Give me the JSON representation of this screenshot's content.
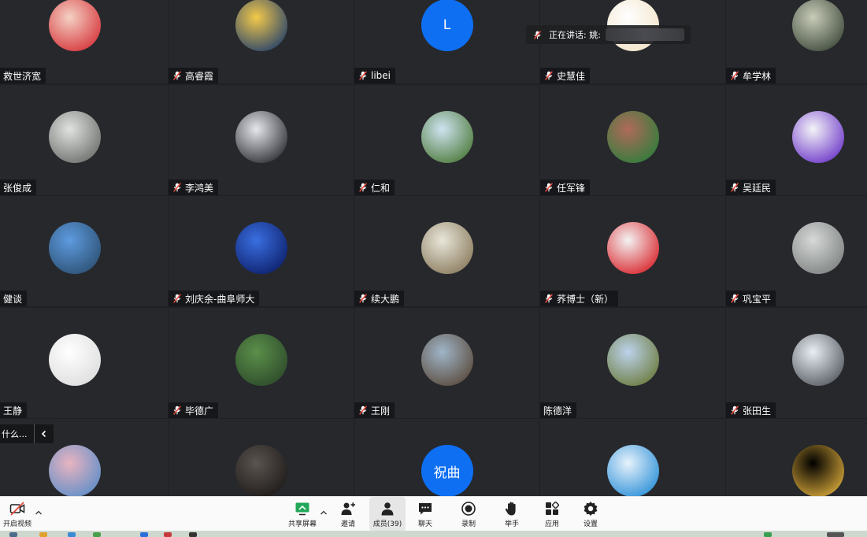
{
  "speaking_label": "正在讲话: 姚:",
  "chat_preview": "什么...",
  "participants": [
    {
      "name": "救世济宽",
      "muted": false,
      "avatar": "photo-child-red-jacket",
      "colors": [
        "#f4d1c4",
        "#d6343a"
      ]
    },
    {
      "name": "高睿霞",
      "muted": true,
      "avatar": "photo-moon-art",
      "colors": [
        "#f3c94a",
        "#24406b"
      ]
    },
    {
      "name": "libei",
      "muted": true,
      "avatar": "letter-avatar",
      "letter": "L",
      "colors": [
        "#0e6ff2",
        "#0e6ff2"
      ]
    },
    {
      "name": "史慧佳",
      "muted": true,
      "avatar": "photo-cartoon-couple",
      "colors": [
        "#ffffff",
        "#f2e3c8"
      ]
    },
    {
      "name": "牟学林",
      "muted": true,
      "avatar": "photo-window-cat",
      "colors": [
        "#c8ccb8",
        "#3f4a3c"
      ]
    },
    {
      "name": "张俊成",
      "muted": false,
      "avatar": "photo-bronze-cauldron",
      "colors": [
        "#e0e3e0",
        "#6b6e6a"
      ]
    },
    {
      "name": "李鸿美",
      "muted": true,
      "avatar": "photo-woman-portrait",
      "colors": [
        "#e6e7ec",
        "#2c2d33"
      ]
    },
    {
      "name": "仁和",
      "muted": true,
      "avatar": "photo-lake-trees",
      "colors": [
        "#cfe3f0",
        "#4c7a3a"
      ]
    },
    {
      "name": "任军锋",
      "muted": true,
      "avatar": "photo-lotus-building",
      "colors": [
        "#b06a5a",
        "#2e7d3a"
      ]
    },
    {
      "name": "吴廷民",
      "muted": true,
      "avatar": "photo-purple-face",
      "colors": [
        "#f4f4f8",
        "#6c36c8"
      ]
    },
    {
      "name": "健谈",
      "muted": false,
      "avatar": "photo-river-town",
      "colors": [
        "#5e9be0",
        "#2c5072"
      ]
    },
    {
      "name": "刘庆余-曲阜师大",
      "muted": true,
      "avatar": "photo-blue-poster",
      "colors": [
        "#3a6fe0",
        "#0d1f6b"
      ]
    },
    {
      "name": "续大鹏",
      "muted": true,
      "avatar": "photo-family-walk",
      "colors": [
        "#e8e6da",
        "#8a7a5c"
      ]
    },
    {
      "name": "荞博士（新）",
      "muted": true,
      "avatar": "photo-boy-flag",
      "colors": [
        "#f3f3f3",
        "#d8232a"
      ]
    },
    {
      "name": "巩宝平",
      "muted": true,
      "avatar": "photo-bubbles",
      "colors": [
        "#d6d9d8",
        "#7d8180"
      ]
    },
    {
      "name": "王静",
      "muted": false,
      "avatar": "photo-meme-face",
      "colors": [
        "#ffffff",
        "#dddddd"
      ]
    },
    {
      "name": "毕德广",
      "muted": true,
      "avatar": "photo-green-forest-deer",
      "colors": [
        "#5b8f4a",
        "#2d4a2a"
      ]
    },
    {
      "name": "王刚",
      "muted": true,
      "avatar": "photo-man-profile",
      "colors": [
        "#9fb5c8",
        "#5a4a3c"
      ]
    },
    {
      "name": "陈德洋",
      "muted": false,
      "avatar": "photo-mountain-cliff",
      "colors": [
        "#bcd2ec",
        "#6b7b3c"
      ]
    },
    {
      "name": "张田生",
      "muted": true,
      "avatar": "photo-baby",
      "colors": [
        "#e8eef4",
        "#555a60"
      ]
    },
    {
      "name": "",
      "muted": false,
      "avatar": "photo-magnolia",
      "colors": [
        "#e8b4c0",
        "#5d8dc8"
      ]
    },
    {
      "name": "",
      "muted": false,
      "avatar": "photo-two-men",
      "colors": [
        "#5b5450",
        "#1d1a18"
      ]
    },
    {
      "name": "",
      "muted": false,
      "avatar": "letter-avatar",
      "letter": "祝曲",
      "colors": [
        "#0e6ff2",
        "#0e6ff2"
      ]
    },
    {
      "name": "",
      "muted": false,
      "avatar": "photo-man-suit",
      "colors": [
        "#e7f2fb",
        "#2a8fd8"
      ]
    },
    {
      "name": "",
      "muted": false,
      "avatar": "photo-gold-confetti",
      "colors": [
        "#000000",
        "#d7a83a"
      ]
    }
  ],
  "toolbar": {
    "video_label": "开启视频",
    "share_label": "共享屏幕",
    "invite_label": "邀请",
    "members_label": "成员(39)",
    "chat_label": "聊天",
    "record_label": "录制",
    "raise_hand_label": "举手",
    "apps_label": "应用",
    "settings_label": "设置"
  },
  "colors": {
    "tile_bg": "#26282c",
    "accent": "#0e6ff2",
    "mute_red": "#e8483c",
    "share_green": "#22a85a"
  }
}
